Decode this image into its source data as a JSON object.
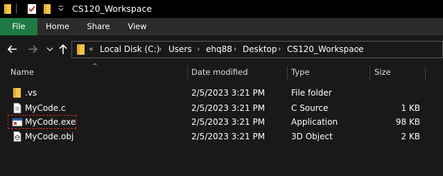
{
  "window": {
    "title": "CS120_Workspace"
  },
  "ribbon": {
    "tabs": [
      {
        "label": "File"
      },
      {
        "label": "Home"
      },
      {
        "label": "Share"
      },
      {
        "label": "View"
      }
    ],
    "active_color": "#1e7a43"
  },
  "address": {
    "prefix": "«",
    "crumbs": [
      "Local Disk (C:)",
      "Users",
      "ehq88",
      "Desktop",
      "CS120_Workspace"
    ]
  },
  "columns": {
    "name": "Name",
    "date": "Date modified",
    "type": "Type",
    "size": "Size"
  },
  "files": [
    {
      "name": ".vs",
      "date": "2/5/2023 3:21 PM",
      "type": "File folder",
      "size": "",
      "icon": "folder-icon"
    },
    {
      "name": "MyCode.c",
      "date": "2/5/2023 3:21 PM",
      "type": "C Source",
      "size": "1 KB",
      "icon": "c-file-icon"
    },
    {
      "name": "MyCode.exe",
      "date": "2/5/2023 3:21 PM",
      "type": "Application",
      "size": "98 KB",
      "icon": "exe-icon",
      "highlighted": true
    },
    {
      "name": "MyCode.obj",
      "date": "2/5/2023 3:21 PM",
      "type": "3D Object",
      "size": "2 KB",
      "icon": "obj-file-icon"
    }
  ],
  "colors": {
    "background": "#191919",
    "titlebar": "#000000",
    "highlight_border": "#e02424",
    "folder": "#f4c542"
  }
}
